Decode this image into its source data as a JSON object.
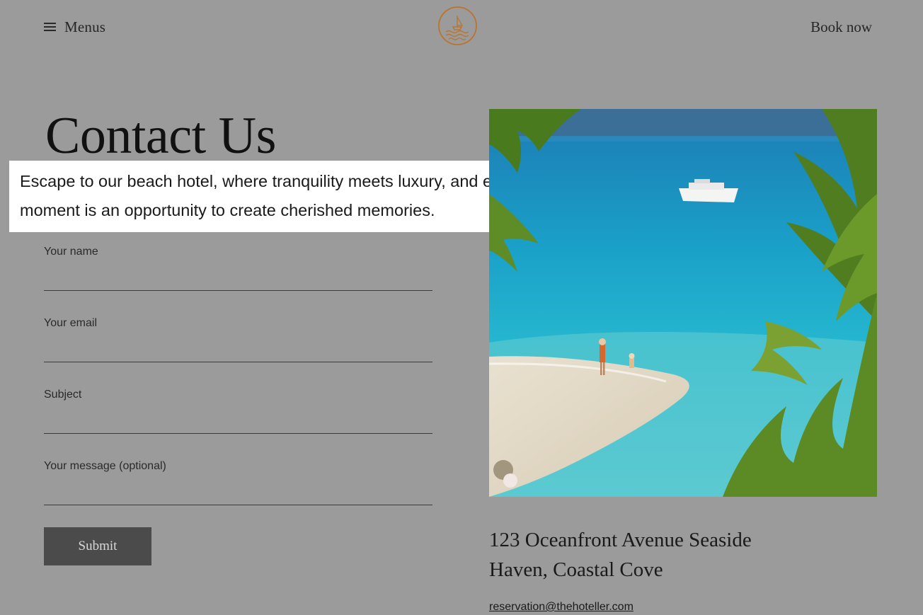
{
  "header": {
    "menu_label": "Menus",
    "book_label": "Book now",
    "menu_icon": "hamburger-icon",
    "logo_icon": "boat-waves-logo"
  },
  "hero": {
    "title": "Contact Us",
    "intro": "Escape to our beach hotel, where tranquility meets luxury, and every moment is an opportunity to create cherished memories."
  },
  "form": {
    "fields": [
      {
        "label": "Your name",
        "value": ""
      },
      {
        "label": "Your email",
        "value": ""
      },
      {
        "label": "Subject",
        "value": ""
      },
      {
        "label": "Your message (optional)",
        "value": ""
      }
    ],
    "submit_label": "Submit"
  },
  "contact": {
    "address_line1": "123 Oceanfront Avenue Seaside",
    "address_line2": "Haven, Coastal Cove",
    "email": "reservation@thehoteller.com"
  },
  "colors": {
    "overlay_bg": "#9b9b9b",
    "logo": "#b9742e",
    "submit_bg": "#4b4b4b",
    "highlight_bg": "#ffffff"
  }
}
